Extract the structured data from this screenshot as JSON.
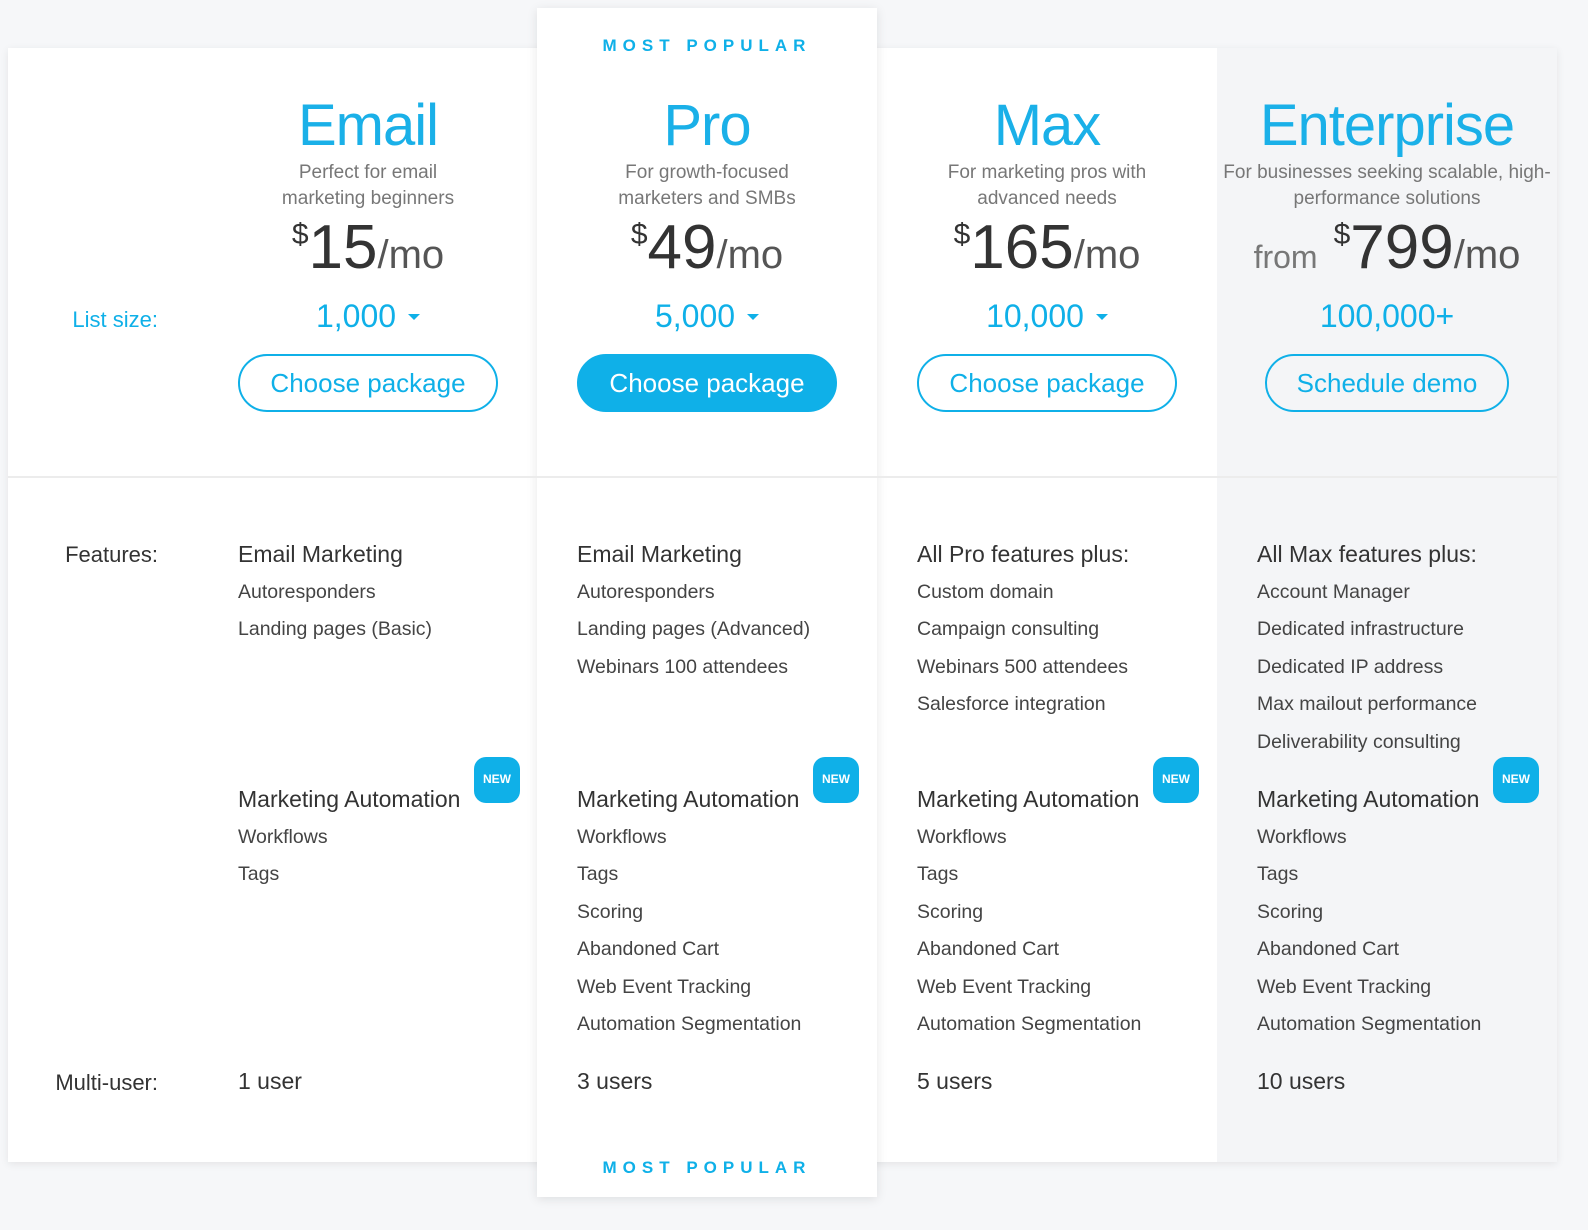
{
  "most_popular_label": "MOST POPULAR",
  "labels": {
    "list_size": "List size:",
    "features": "Features:",
    "multi_user": "Multi-user:"
  },
  "new_badge": "NEW",
  "automation_heading": "Marketing Automation",
  "plans": [
    {
      "name": "Email",
      "description": "Perfect for email marketing beginners",
      "price_prefix": "",
      "currency": "$",
      "amount": "15",
      "period": "/mo",
      "list_size": "1,000",
      "has_dropdown": true,
      "button": "Choose package",
      "features_heading": "Email Marketing",
      "features": [
        "Autoresponders",
        "Landing pages (Basic)"
      ],
      "automation": [
        "Workflows",
        "Tags"
      ],
      "users": "1 user"
    },
    {
      "name": "Pro",
      "description": "For growth-focused marketers and SMBs",
      "price_prefix": "",
      "currency": "$",
      "amount": "49",
      "period": "/mo",
      "list_size": "5,000",
      "has_dropdown": true,
      "button": "Choose package",
      "features_heading": "Email Marketing",
      "features": [
        "Autoresponders",
        "Landing pages (Advanced)",
        "Webinars 100 attendees"
      ],
      "automation": [
        "Workflows",
        "Tags",
        "Scoring",
        "Abandoned Cart",
        "Web Event Tracking",
        "Automation Segmentation"
      ],
      "users": "3 users"
    },
    {
      "name": "Max",
      "description": "For marketing pros with advanced needs",
      "price_prefix": "",
      "currency": "$",
      "amount": "165",
      "period": "/mo",
      "list_size": "10,000",
      "has_dropdown": true,
      "button": "Choose package",
      "features_heading": "All Pro features plus:",
      "features": [
        "Custom domain",
        "Campaign consulting",
        "Webinars 500 attendees",
        "Salesforce integration"
      ],
      "automation": [
        "Workflows",
        "Tags",
        "Scoring",
        "Abandoned Cart",
        "Web Event Tracking",
        "Automation Segmentation"
      ],
      "users": "5 users"
    },
    {
      "name": "Enterprise",
      "description": "For businesses seeking scalable, high-performance solutions",
      "price_prefix": "from",
      "currency": "$",
      "amount": "799",
      "period": "/mo",
      "list_size": "100,000+",
      "has_dropdown": false,
      "button": "Schedule demo",
      "features_heading": "All Max features plus:",
      "features": [
        "Account Manager",
        "Dedicated infrastructure",
        "Dedicated IP address",
        "Max mailout performance",
        "Deliverability consulting"
      ],
      "automation": [
        "Workflows",
        "Tags",
        "Scoring",
        "Abandoned Cart",
        "Web Event Tracking",
        "Automation Segmentation"
      ],
      "users": "10 users"
    }
  ],
  "colors": {
    "accent": "#0fb0e8",
    "text": "#333333"
  }
}
